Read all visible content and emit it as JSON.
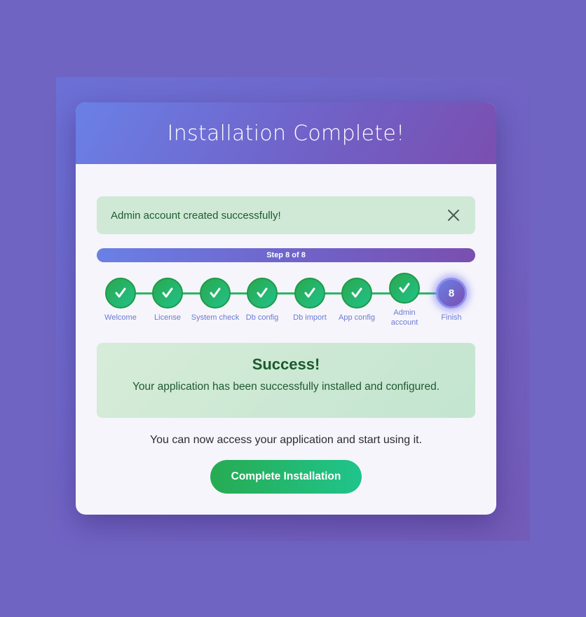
{
  "header": {
    "title": "Installation Complete!"
  },
  "alert": {
    "message": "Admin account created successfully!",
    "close_icon": "close-icon"
  },
  "progress": {
    "label": "Step 8 of 8",
    "fraction": 1.0
  },
  "steps": [
    {
      "label": "Welcome",
      "status": "completed"
    },
    {
      "label": "License",
      "status": "completed"
    },
    {
      "label": "System check",
      "status": "completed"
    },
    {
      "label": "Db config",
      "status": "completed"
    },
    {
      "label": "Db import",
      "status": "completed"
    },
    {
      "label": "App config",
      "status": "completed"
    },
    {
      "label": "Admin account",
      "status": "completed"
    },
    {
      "label": "Finish",
      "status": "active",
      "number": "8"
    }
  ],
  "success": {
    "heading": "Success!",
    "message": "Your application has been successfully installed and configured."
  },
  "access_message": "You can now access your application and start using it.",
  "complete_button": {
    "label": "Complete Installation"
  },
  "colors": {
    "background": "#7064c2",
    "header_gradient_start": "#6a80e6",
    "header_gradient_end": "#7a4fb0",
    "success_green": "#2aa84e",
    "alert_bg": "#cfe9d6"
  }
}
